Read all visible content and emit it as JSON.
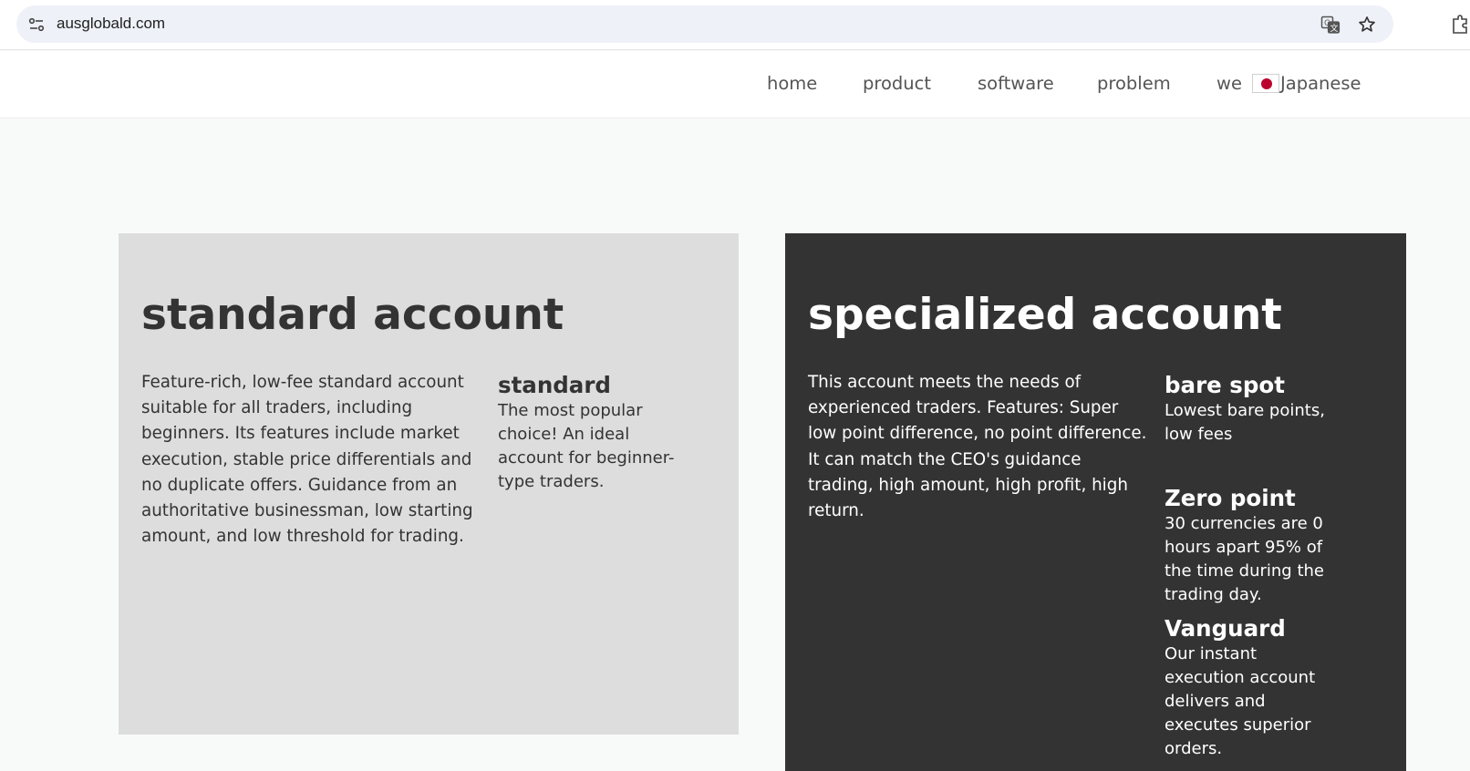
{
  "browser": {
    "url": "ausglobald.com",
    "icons": [
      "site-info-icon",
      "translate-icon",
      "star-icon",
      "extensions-icon"
    ]
  },
  "nav": {
    "items": [
      "home",
      "product",
      "software",
      "problem",
      "we"
    ],
    "language": {
      "label": "Japanese",
      "icon": "japan-flag-icon"
    }
  },
  "cards": {
    "standard": {
      "title": "standard account",
      "description": "Feature-rich, low-fee standard account suitable for all traders, including beginners. Its features include market execution, stable price differentials and no duplicate offers. Guidance from an authoritative businessman, low starting amount, and low threshold for trading.",
      "features": [
        {
          "title": "standard",
          "text": "The most popular choice! An ideal account for beginner-type traders."
        }
      ]
    },
    "specialized": {
      "title": "specialized account",
      "description": "This account meets the needs of experienced traders. Features: Super low point difference, no point difference. It can match the CEO's guidance trading, high amount, high profit, high return.",
      "features": [
        {
          "title": "bare spot",
          "text": "Lowest bare points, low fees"
        },
        {
          "title": "Zero point",
          "text": "30 currencies are 0 hours apart 95% of the time during the trading day."
        },
        {
          "title": "Vanguard",
          "text": "Our instant execution account delivers and executes superior orders."
        }
      ]
    }
  },
  "colors": {
    "standard_card_bg": "#dddddd",
    "specialized_card_bg": "#333333",
    "page_bg": "#f8f9f9"
  }
}
